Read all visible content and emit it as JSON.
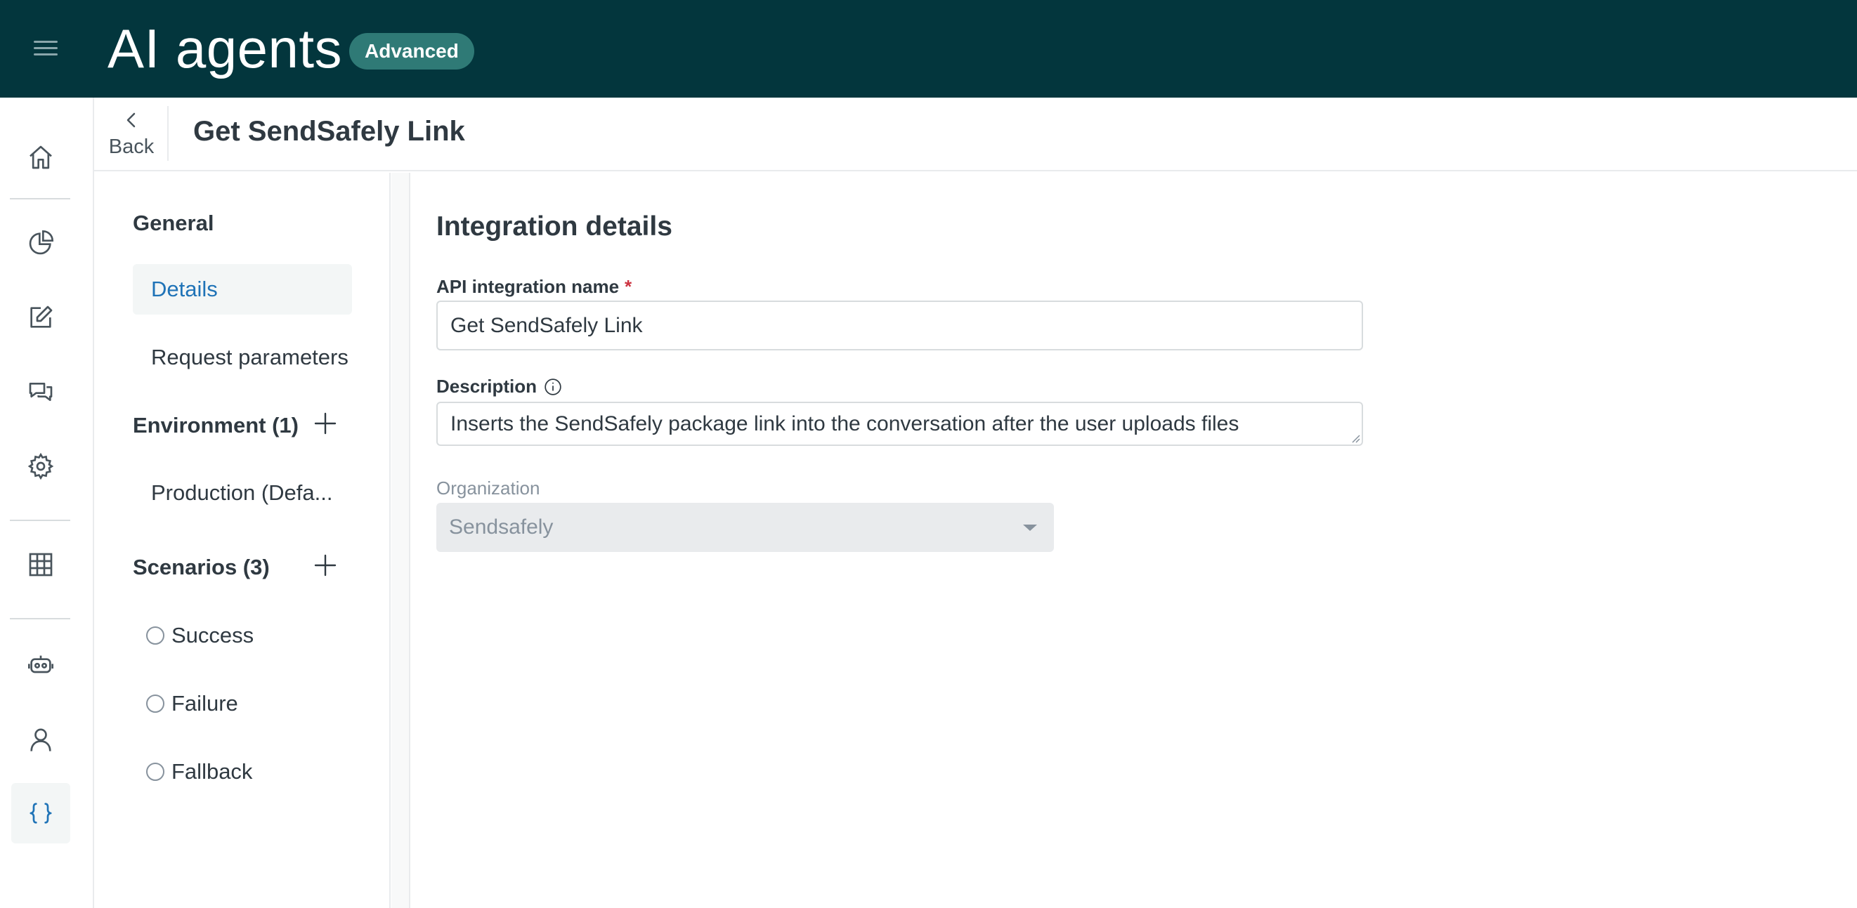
{
  "app": {
    "title": "AI agents",
    "badge": "Advanced"
  },
  "rail": {
    "icons": [
      "home-icon",
      "reports-pie-icon",
      "edit-icon",
      "conversations-icon",
      "settings-gear-icon",
      "table-grid-icon",
      "bot-icon",
      "user-icon",
      "braces-icon"
    ],
    "active": "braces-icon"
  },
  "header": {
    "back_label": "Back",
    "page_title": "Get SendSafely Link"
  },
  "subnav": {
    "general_heading": "General",
    "general_items": [
      {
        "label": "Details",
        "active": true
      },
      {
        "label": "Request parameters",
        "active": false
      }
    ],
    "environment_heading": "Environment (1)",
    "environment_items": [
      {
        "label": "Production (Defa..."
      }
    ],
    "scenarios_heading": "Scenarios (3)",
    "scenarios": [
      {
        "label": "Success"
      },
      {
        "label": "Failure"
      },
      {
        "label": "Fallback"
      }
    ]
  },
  "main": {
    "section_title": "Integration details",
    "name_field": {
      "label": "API integration name",
      "required_mark": "*",
      "value": "Get SendSafely Link"
    },
    "description_field": {
      "label": "Description",
      "value": "Inserts the SendSafely package link into the conversation after the user uploads files"
    },
    "organization_field": {
      "label": "Organization",
      "value": "Sendsafely",
      "disabled": true
    }
  },
  "colors": {
    "topbar": "#03363d",
    "badge": "#2f7a76",
    "accent": "#1f73b7",
    "required": "#cc3340"
  }
}
